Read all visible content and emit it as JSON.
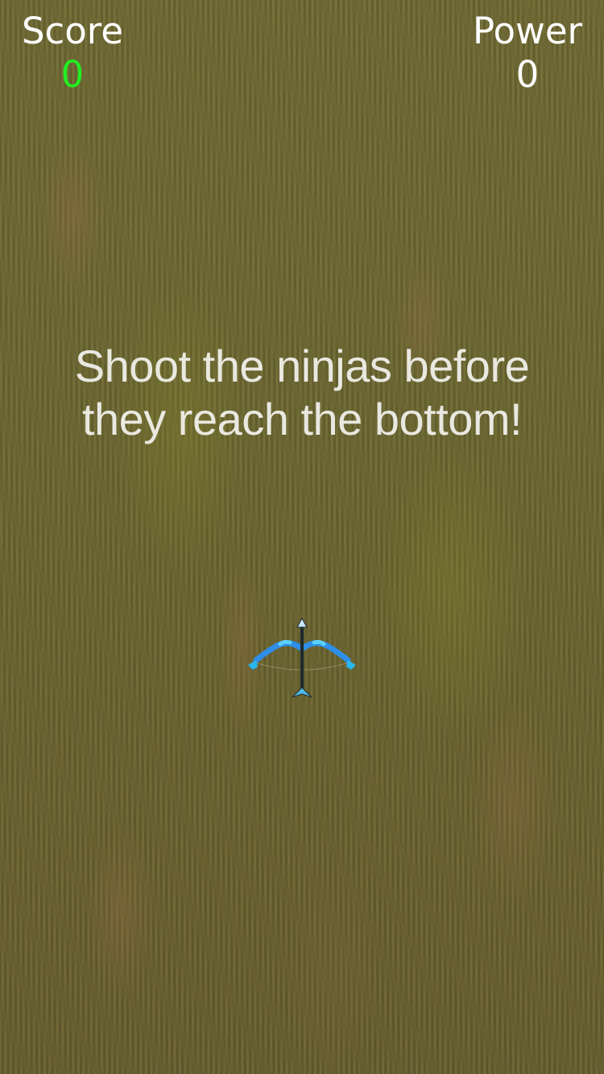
{
  "hud": {
    "score_label": "Score",
    "score_value": "0",
    "power_label": "Power",
    "power_value": "0"
  },
  "instructions": {
    "line1": "Shoot the ninjas before",
    "line2": "they reach the bottom!"
  },
  "colors": {
    "score_value": "#22ee22",
    "power_value": "#ffffff",
    "bow": "#2e8ee8",
    "arrow": "#1f2a2a"
  },
  "icons": {
    "player": "bow-and-arrow-icon"
  }
}
